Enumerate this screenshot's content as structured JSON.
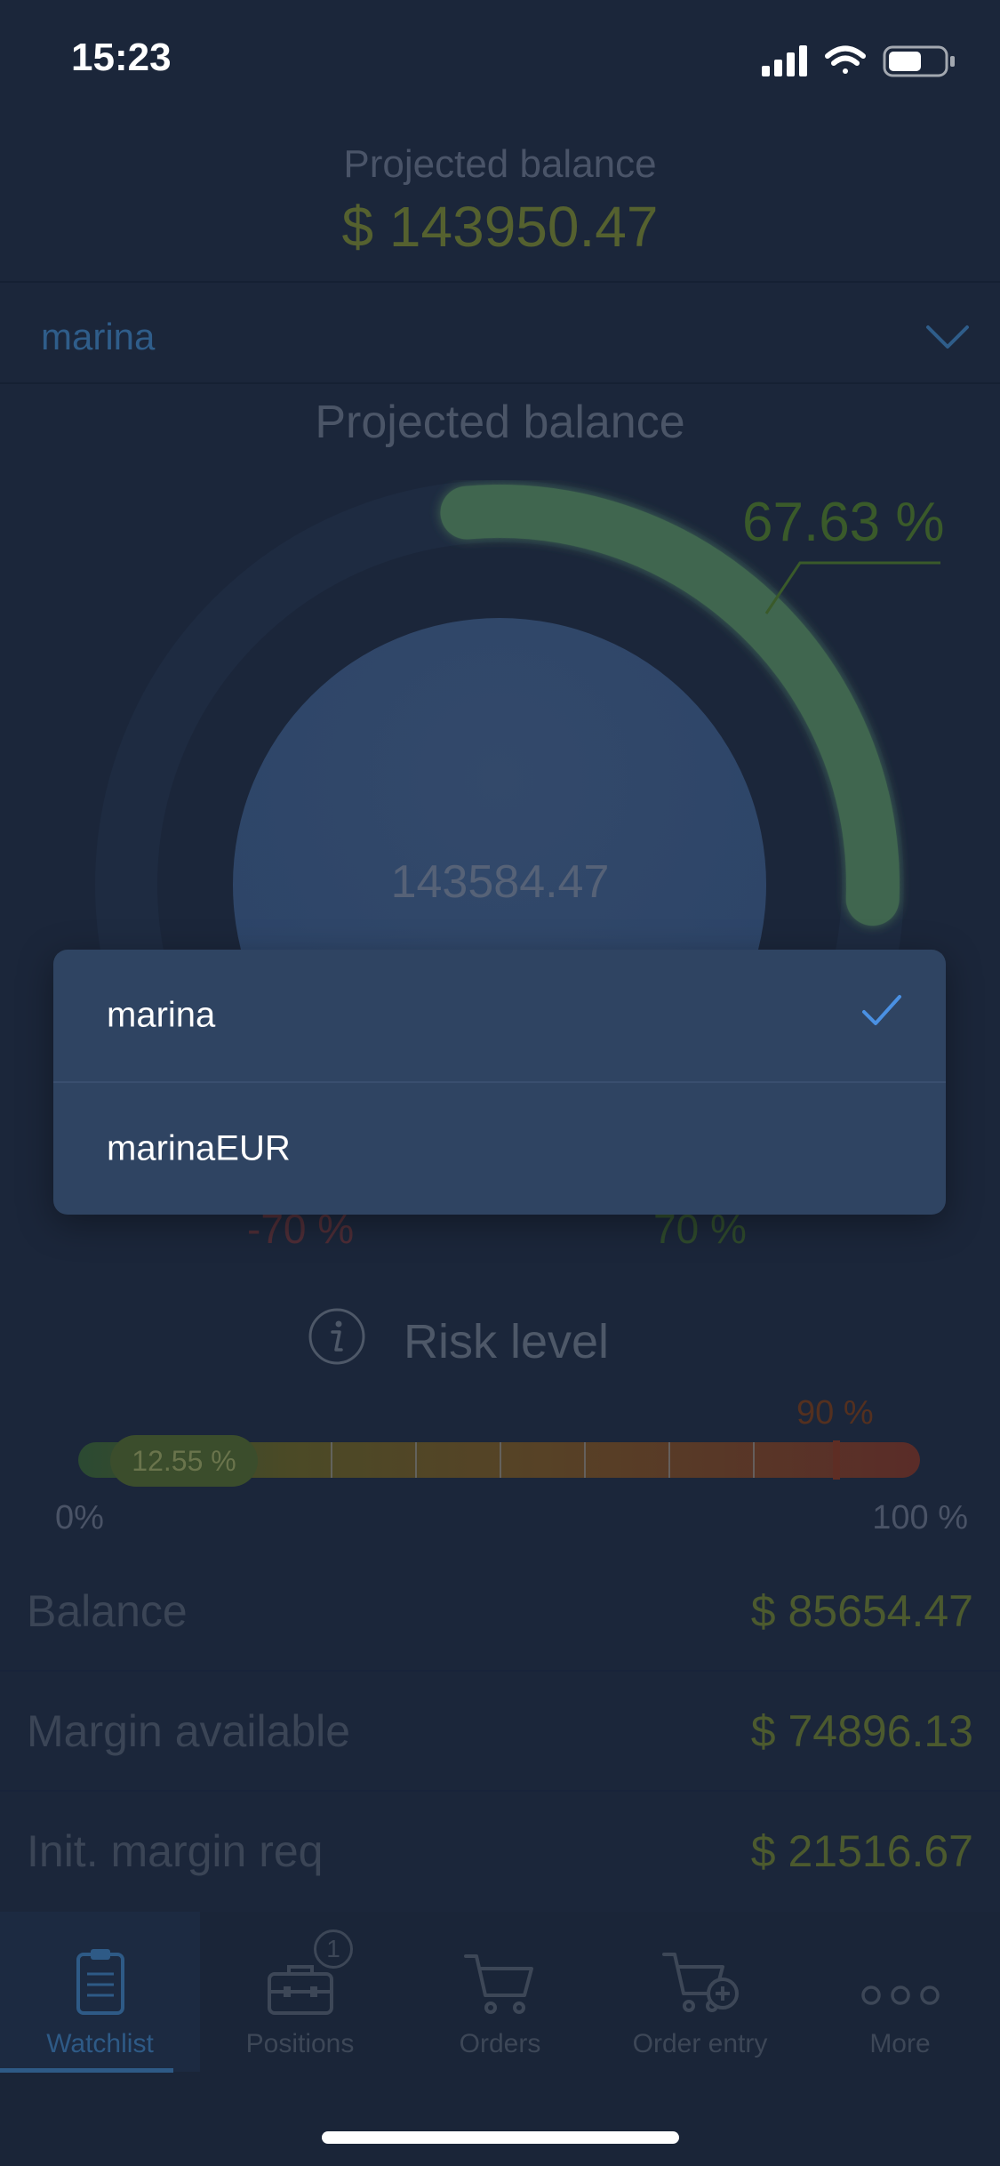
{
  "status_bar": {
    "time": "15:23"
  },
  "header": {
    "title": "Projected balance",
    "value": "$ 143950.47"
  },
  "account_selector": {
    "selected": "marina"
  },
  "section": {
    "title": "Projected balance"
  },
  "gauge": {
    "percent_label": "67.63 %",
    "center_value": "143584.47",
    "fill_percent": 67.63,
    "neg_label": "-70 %",
    "pos_label": "70 %"
  },
  "risk": {
    "title": "Risk level",
    "value_label": "12.55 %",
    "value": 12.55,
    "threshold_label": "90 %",
    "min_label": "0%",
    "max_label": "100 %"
  },
  "rows": [
    {
      "label": "Balance",
      "value": "$ 85654.47"
    },
    {
      "label": "Margin available",
      "value": "$ 74896.13"
    },
    {
      "label": "Init. margin req",
      "value": "$ 21516.67"
    }
  ],
  "tabbar": {
    "tabs": [
      {
        "label": "Watchlist",
        "icon": "clipboard-icon",
        "active": true
      },
      {
        "label": "Positions",
        "icon": "briefcase-icon",
        "badge": "1"
      },
      {
        "label": "Orders",
        "icon": "cart-icon"
      },
      {
        "label": "Order entry",
        "icon": "cart-plus-icon"
      },
      {
        "label": "More",
        "icon": "more-dots-icon"
      }
    ]
  },
  "dropdown": {
    "options": [
      {
        "label": "marina",
        "selected": true
      },
      {
        "label": "marinaEUR",
        "selected": false
      }
    ]
  },
  "colors": {
    "background": "#1b263a",
    "accent": "#2e5a86",
    "positive": "#4c5a2e",
    "dropdown": "#2f4462"
  }
}
